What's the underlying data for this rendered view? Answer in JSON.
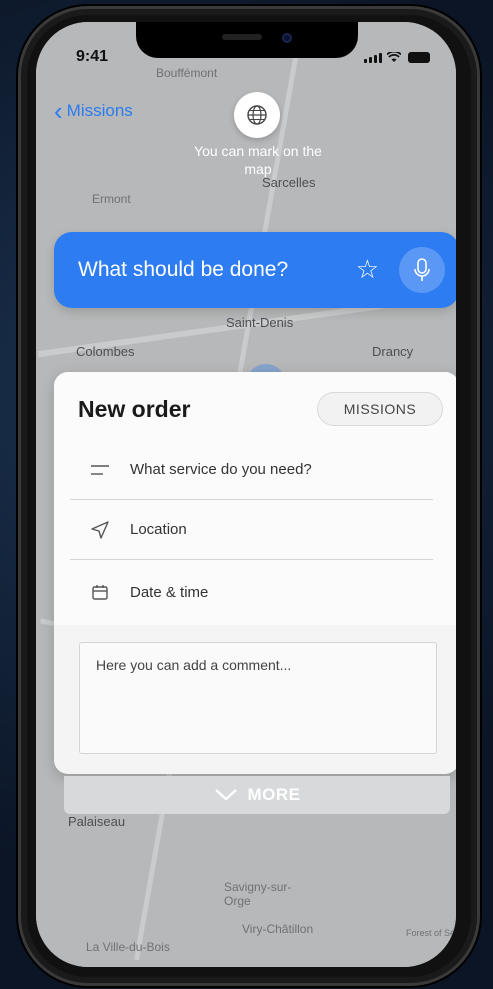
{
  "status_bar": {
    "time": "9:41"
  },
  "nav": {
    "back_label": "Missions"
  },
  "map": {
    "hint": "You can mark on the map",
    "labels": [
      "Bouffémont",
      "Ermont",
      "Sarcelles",
      "Saint-Denis",
      "Colombes",
      "Drancy",
      "Palaiseau",
      "Savigny-sur-Orge",
      "Viry-Châtillon",
      "La Ville-du-Bois",
      "Forest of Sé"
    ]
  },
  "ask_bar": {
    "placeholder": "What should be done?"
  },
  "order_card": {
    "title": "New order",
    "missions_button": "MISSIONS",
    "fields": [
      {
        "icon": "lines-icon",
        "label": "What service do you need?"
      },
      {
        "icon": "location-arrow-icon",
        "label": "Location"
      },
      {
        "icon": "calendar-icon",
        "label": "Date & time"
      }
    ],
    "comment_placeholder": "Here you can add a comment..."
  },
  "more_button": {
    "label": "MORE"
  },
  "colors": {
    "accent": "#2d7cf2",
    "card": "#fbfbfb",
    "background": "#0d1b2e"
  }
}
